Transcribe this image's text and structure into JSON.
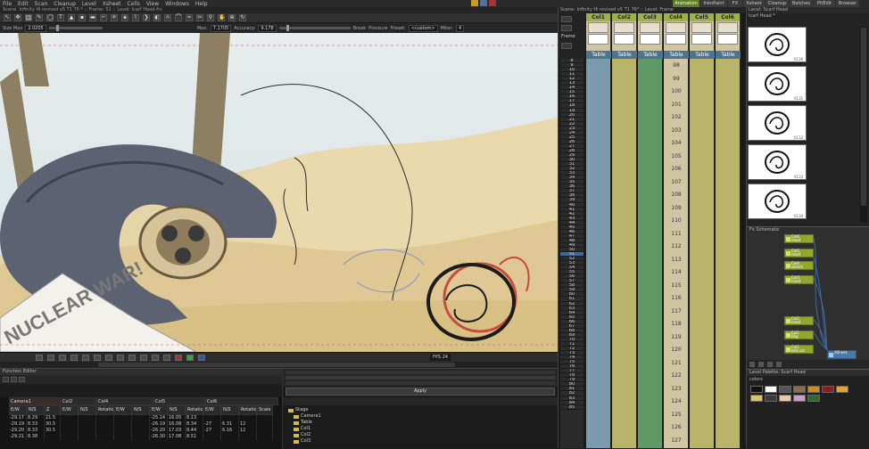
{
  "menu": [
    "File",
    "Edit",
    "Scan",
    "Cleanup",
    "Level",
    "Xsheet",
    "Cells",
    "View",
    "Windows",
    "Help"
  ],
  "room_tabs": [
    {
      "label": "Animation",
      "active": true
    },
    {
      "label": "InknPaint",
      "active": false
    },
    {
      "label": "FX",
      "active": false
    },
    {
      "label": "Xsheet",
      "active": false
    },
    {
      "label": "Cleanup",
      "active": false
    },
    {
      "label": "Batches",
      "active": false
    },
    {
      "label": "PltEdit",
      "active": false
    },
    {
      "label": "Browser",
      "active": false
    }
  ],
  "viewer": {
    "title": "Scene: Infinity Hi revised v5 T1 76 *  ::  Frame: 51  ::  Level: lcarf Head-frs",
    "toolprops": {
      "size_label": "Size Max",
      "size_value": "2.0205",
      "max_label": "Max:",
      "max_value": "7.1705",
      "accuracy_label": "Accuracy:",
      "accuracy_value": "9.178",
      "break_label": "Break",
      "pressure_label": "Pressure",
      "preset_label": "Preset:",
      "preset_value": "<custom>",
      "miter_label": "Miter:",
      "miter_value": "4"
    },
    "fps_label": "FPS",
    "fps_value": "24",
    "newspaper_text": "NUCLEAR WAR!"
  },
  "function_editor": {
    "title": "Function Editor",
    "groups": [
      "Camera1",
      "Col2",
      "Col4",
      "Col5",
      "Col6"
    ],
    "headers": [
      "E/W",
      "N/S",
      "Z",
      "E/W",
      "N/S",
      "Rotation",
      "E/W",
      "N/S",
      "E/W",
      "N/S",
      "Rotation",
      "E/W",
      "N/S",
      "Rotation",
      "Scale"
    ],
    "rows": [
      [
        "-29.17",
        "8.29",
        "21.5",
        "",
        "",
        "",
        "",
        "",
        "-25.14",
        "16.05",
        "8.13",
        "",
        "",
        "",
        ""
      ],
      [
        "-29.19",
        "8.33",
        "30.5",
        "",
        "",
        "",
        "",
        "",
        "-26.19",
        "16.08",
        "8.34",
        "-27",
        "6.31",
        "12",
        ""
      ],
      [
        "-29.20",
        "8.33",
        "30.5",
        "",
        "",
        "",
        "",
        "",
        "-26.20",
        "17.03",
        "8.44",
        "-27",
        "6.16",
        "12",
        ""
      ],
      [
        "-29.21",
        "8.38",
        "",
        "",
        "",
        "",
        "",
        "",
        "-26.30",
        "17.08",
        "8.51",
        "",
        "",
        "",
        ""
      ]
    ]
  },
  "stage_panel": {
    "apply_label": "Apply",
    "tree": [
      "Stage",
      "Camera1",
      "Table",
      "Col1",
      "Col2",
      "Col3"
    ]
  },
  "xsheet": {
    "title": "Scene: Infinity Hi revised v5 T1 76* :: Level: Frame",
    "frame_label": "Frame",
    "columns": [
      {
        "name": "Col1",
        "cell_name": "Table",
        "color": "#7a9aae"
      },
      {
        "name": "Col2",
        "cell_name": "Table",
        "color": "#b9b46a"
      },
      {
        "name": "Col3",
        "cell_name": "Table",
        "color": "#5f9a66"
      },
      {
        "name": "Col4",
        "cell_name": "Table",
        "color": "#cfc7a3"
      },
      {
        "name": "Col5",
        "cell_name": "Table",
        "color": "#b9b46a"
      },
      {
        "name": "Col6",
        "cell_name": "Table",
        "color": "#b9b46a"
      }
    ],
    "frames": [
      "8",
      "9",
      "10",
      "11",
      "12",
      "13",
      "14",
      "15",
      "16",
      "17",
      "18",
      "19",
      "20",
      "21",
      "22",
      "23",
      "24",
      "25",
      "26",
      "27",
      "28",
      "29",
      "30",
      "31",
      "32",
      "33",
      "34",
      "35",
      "36",
      "37",
      "38",
      "39",
      "40",
      "41",
      "42",
      "43",
      "44",
      "45",
      "46",
      "47",
      "48",
      "49",
      "50",
      "51",
      "52",
      "53",
      "54",
      "55",
      "56",
      "57",
      "58",
      "59",
      "60",
      "61",
      "62",
      "63",
      "64",
      "65",
      "66",
      "67",
      "68",
      "69",
      "70",
      "71",
      "72",
      "73",
      "74",
      "75",
      "76",
      "77",
      "78",
      "79",
      "80",
      "81",
      "82",
      "83",
      "84",
      "85"
    ],
    "col4_cells": [
      "98",
      "99",
      "100",
      "101",
      "102",
      "103",
      "104",
      "105",
      "106",
      "107",
      "108",
      "109",
      "110",
      "111",
      "112",
      "113",
      "114",
      "115",
      "116",
      "117",
      "118",
      "119",
      "120",
      "121",
      "122",
      "123",
      "124",
      "125",
      "126",
      "127"
    ]
  },
  "library": {
    "title": "Level: Scarf Head",
    "subtitle": "lcarf Head *",
    "thumb_ids": [
      "0130",
      "0131",
      "0132",
      "0133",
      "0134"
    ]
  },
  "nodes": {
    "title": "Fx Schematic",
    "items": [
      {
        "label": "Col6",
        "sub": "head",
        "type": "col"
      },
      {
        "label": "Col5",
        "sub": "head",
        "type": "col"
      },
      {
        "label": "Col4",
        "sub": "sketch",
        "type": "col"
      },
      {
        "label": "Col3",
        "sub": "head",
        "type": "col"
      },
      {
        "label": "Col2",
        "sub": "head",
        "type": "col"
      },
      {
        "label": "Col1",
        "sub": "Bkg",
        "type": "col"
      },
      {
        "label": "Col1",
        "sub": "bkd.cut",
        "type": "col"
      },
      {
        "label": "XSheet",
        "sub": "",
        "type": "comp"
      }
    ]
  },
  "colors": {
    "title": "Level Palette: Scarf Head",
    "palette_name": "colors",
    "swatches": [
      "#111111",
      "#ffffff",
      "#555555",
      "#8a6a4a",
      "#c98a2a",
      "#8b1e1e",
      "#e3a13b",
      "#d6c36a",
      "#3a3a3a",
      "#e8c9a9",
      "#c4a0c8",
      "#2f6b2f"
    ]
  }
}
